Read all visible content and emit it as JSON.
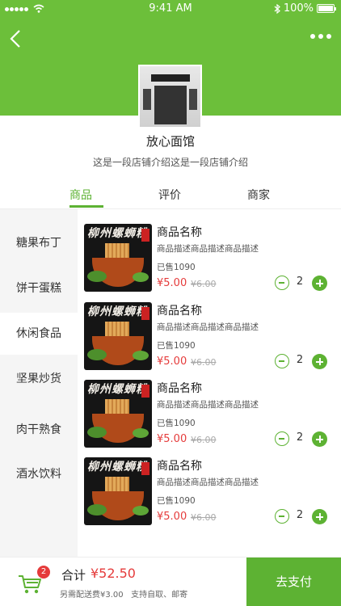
{
  "status_bar": {
    "time": "9:41 AM",
    "battery": "100%"
  },
  "shop": {
    "name": "放心面馆",
    "intro": "这是一段店铺介绍这是一段店铺介绍"
  },
  "tabs": [
    {
      "label": "商品",
      "active": true
    },
    {
      "label": "评价",
      "active": false
    },
    {
      "label": "商家",
      "active": false
    }
  ],
  "categories": [
    {
      "label": "糖果布丁",
      "active": false
    },
    {
      "label": "饼干蛋糕",
      "active": false
    },
    {
      "label": "休闲食品",
      "active": true
    },
    {
      "label": "坚果炒货",
      "active": false
    },
    {
      "label": "肉干熟食",
      "active": false
    },
    {
      "label": "酒水饮料",
      "active": false
    }
  ],
  "products": [
    {
      "image_text": "柳州螺蛳粉",
      "name": "商品名称",
      "desc": "商品描述商品描述商品描述",
      "sold": "已售1090",
      "price": "¥5.00",
      "original_price": "¥6.00",
      "qty": "2"
    },
    {
      "image_text": "柳州螺蛳粉",
      "name": "商品名称",
      "desc": "商品描述商品描述商品描述",
      "sold": "已售1090",
      "price": "¥5.00",
      "original_price": "¥6.00",
      "qty": "2"
    },
    {
      "image_text": "柳州螺蛳粉",
      "name": "商品名称",
      "desc": "商品描述商品描述商品描述",
      "sold": "已售1090",
      "price": "¥5.00",
      "original_price": "¥6.00",
      "qty": "2"
    },
    {
      "image_text": "柳州螺蛳粉",
      "name": "商品名称",
      "desc": "商品描述商品描述商品描述",
      "sold": "已售1090",
      "price": "¥5.00",
      "original_price": "¥6.00",
      "qty": "2"
    }
  ],
  "cart": {
    "badge_count": "2",
    "total_label": "合计",
    "total_amount": "¥52.50",
    "delivery_note": "另需配送费¥3.00   支持自取、邮寄",
    "pay_label": "去支付"
  },
  "colors": {
    "brand_green": "#5db233",
    "price_red": "#e53b3b",
    "header_green": "#6cbf3a"
  }
}
